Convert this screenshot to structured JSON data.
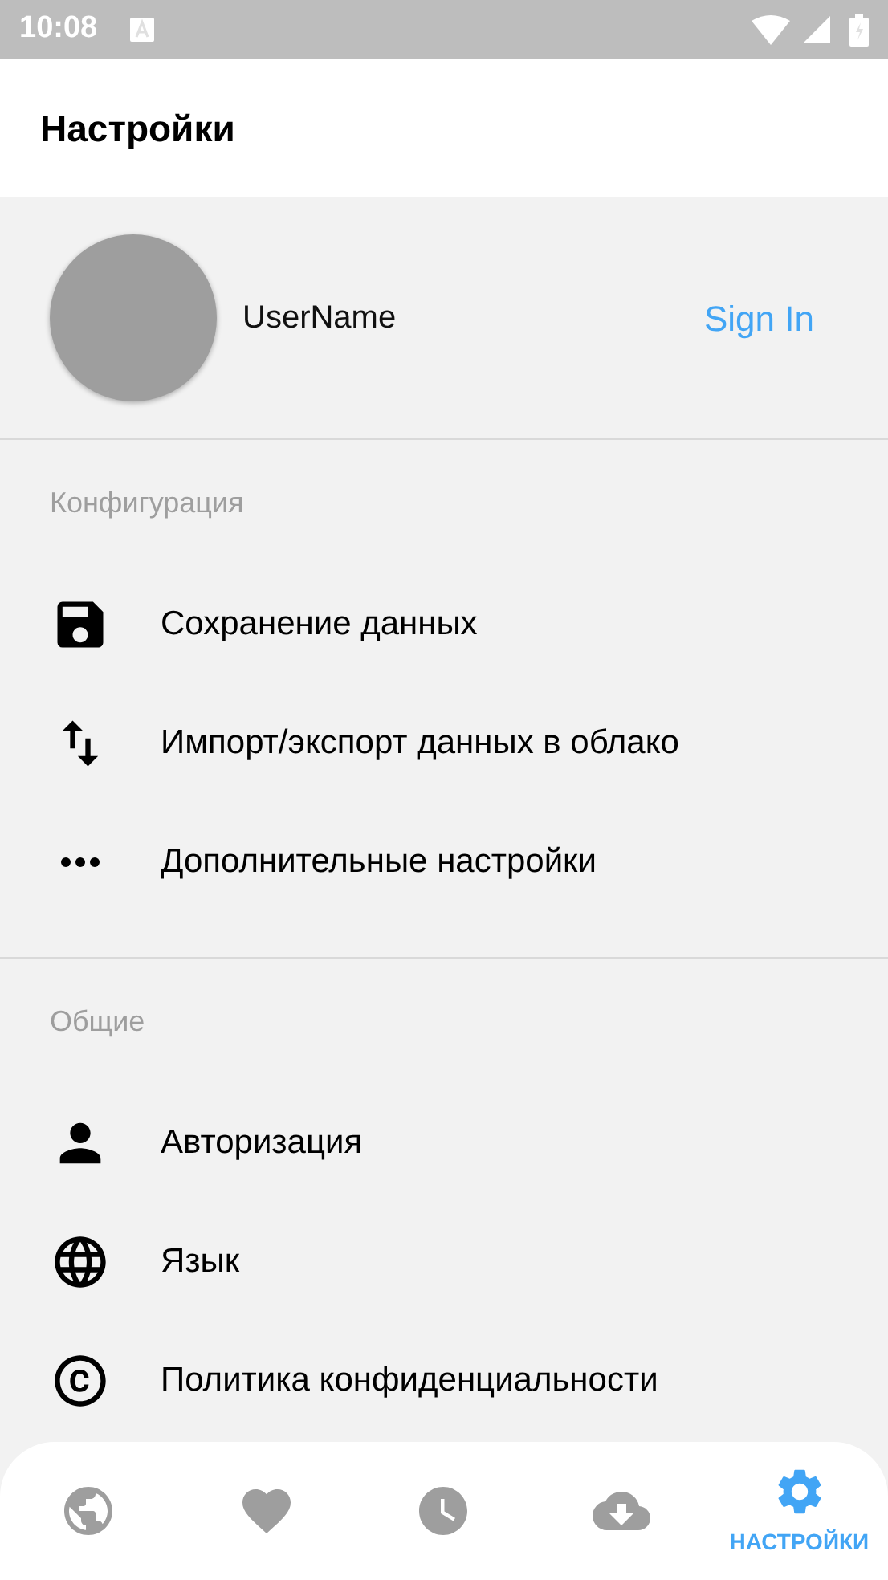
{
  "status_bar": {
    "time": "10:08"
  },
  "header": {
    "title": "Настройки"
  },
  "profile": {
    "username": "UserName",
    "sign_in": "Sign In"
  },
  "sections": [
    {
      "title": "Конфигурация",
      "items": [
        {
          "label": "Сохранение данных"
        },
        {
          "label": "Импорт/экспорт данных в облако"
        },
        {
          "label": "Дополнительные настройки"
        }
      ]
    },
    {
      "title": "Общие",
      "items": [
        {
          "label": "Авторизация"
        },
        {
          "label": "Язык"
        },
        {
          "label": "Политика конфиденциальности"
        }
      ]
    }
  ],
  "bottom_nav": [
    {
      "selected": false
    },
    {
      "selected": false
    },
    {
      "selected": false
    },
    {
      "selected": false
    },
    {
      "selected": true,
      "label": "НАСТРОЙКИ"
    }
  ]
}
